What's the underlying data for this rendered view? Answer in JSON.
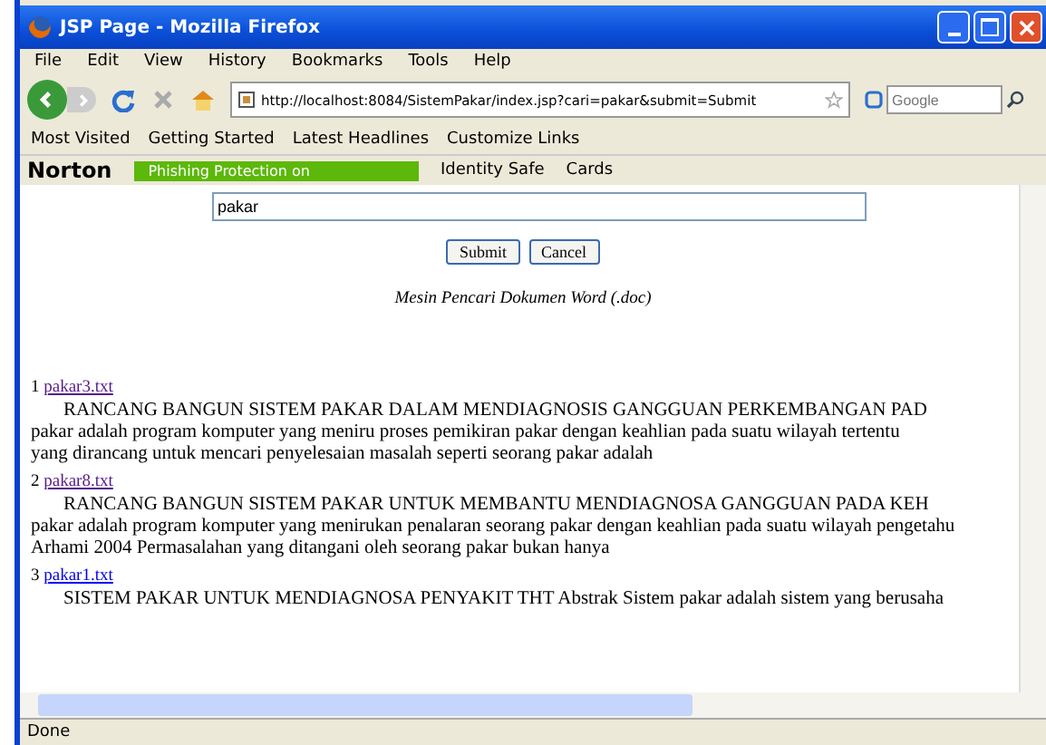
{
  "window": {
    "title": "JSP Page - Mozilla Firefox"
  },
  "menu": [
    "File",
    "Edit",
    "View",
    "History",
    "Bookmarks",
    "Tools",
    "Help"
  ],
  "address": {
    "value": "http://localhost:8084/SistemPakar/index.jsp?cari=pakar&submit=Submit"
  },
  "search": {
    "placeholder": "Google"
  },
  "bookmarks": [
    "Most Visited",
    "Getting Started",
    "Latest Headlines",
    "Customize Links"
  ],
  "norton": {
    "brand": "Norton",
    "phishing": "Phishing Protection on",
    "identity": "Identity Safe",
    "cards": "Cards"
  },
  "form": {
    "query": "pakar",
    "buttons": [
      "Submit",
      "Cancel"
    ],
    "caption": "Mesin Pencari Dokumen Word (.doc)"
  },
  "results": [
    {
      "number": "1",
      "link": "pakar3.txt",
      "visited": true,
      "lines": [
        "RANCANG BANGUN SISTEM PAKAR DALAM MENDIAGNOSIS GANGGUAN PERKEMBANGAN PAD",
        "pakar adalah program komputer yang meniru proses pemikiran pakar dengan keahlian pada suatu wilayah tertentu",
        "yang dirancang untuk mencari penyelesaian masalah seperti seorang pakar adalah"
      ]
    },
    {
      "number": "2",
      "link": "pakar8.txt",
      "visited": true,
      "lines": [
        "RANCANG BANGUN SISTEM PAKAR UNTUK MEMBANTU MENDIAGNOSA GANGGUAN PADA KEH",
        "pakar adalah program komputer yang menirukan penalaran seorang pakar dengan keahlian pada suatu wilayah pengetahu",
        "Arhami 2004 Permasalahan yang ditangani oleh seorang pakar bukan hanya"
      ]
    },
    {
      "number": "3",
      "link": "pakar1.txt",
      "visited": false,
      "lines": [
        "SISTEM PAKAR UNTUK MENDIAGNOSA PENYAKIT THT Abstrak Sistem pakar adalah sistem yang berusaha"
      ]
    }
  ],
  "status": "Done"
}
